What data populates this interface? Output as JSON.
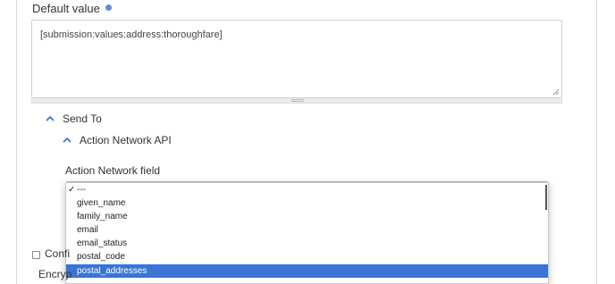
{
  "default_value": {
    "label": "Default value",
    "info_icon": "info-icon",
    "textarea_value": "[submission:values:address:thoroughfare]"
  },
  "send_to": {
    "label": "Send To",
    "icon": "chevron-up-icon"
  },
  "action_network": {
    "label": "Action Network API",
    "icon": "chevron-up-icon",
    "field_label": "Action Network field",
    "checked_option_index": 0,
    "highlighted_option_index": 6,
    "options": [
      "---",
      "given_name",
      "family_name",
      "email",
      "email_status",
      "postal_code",
      "postal_addresses"
    ]
  },
  "confirm": {
    "label": "Confi"
  },
  "encrypt": {
    "label": "Encryp"
  },
  "colors": {
    "highlight": "#3a74d4",
    "info_icon": "#5b8edc",
    "chevron": "#4a84d9"
  }
}
